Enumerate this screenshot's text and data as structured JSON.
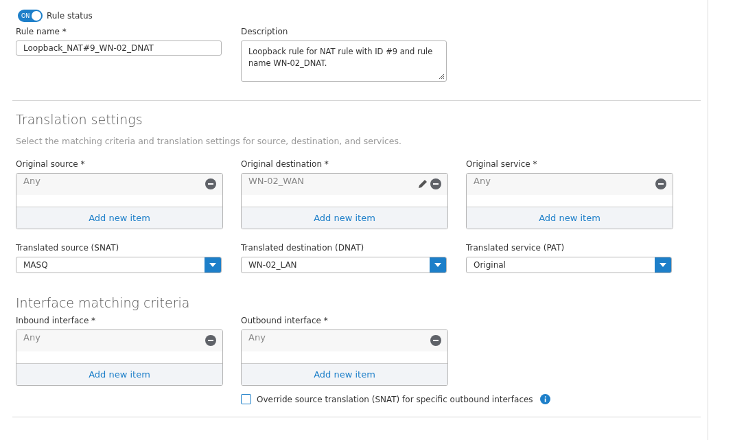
{
  "rule_status": {
    "label": "Rule status",
    "on": true,
    "switch_text": "ON"
  },
  "rule_name": {
    "label": "Rule name *",
    "value": "Loopback_NAT#9_WN-02_DNAT"
  },
  "description": {
    "label": "Description",
    "value": "Loopback rule for NAT rule with ID #9 and rule name WN-02_DNAT."
  },
  "translation_settings": {
    "title": "Translation settings",
    "subtitle": "Select the matching criteria and translation settings for source, destination, and services.",
    "lists": [
      {
        "label": "Original source *",
        "item": "Any",
        "editable": false,
        "add_label": "Add new item"
      },
      {
        "label": "Original destination *",
        "item": "WN-02_WAN",
        "editable": true,
        "add_label": "Add new item"
      },
      {
        "label": "Original service *",
        "item": "Any",
        "editable": false,
        "add_label": "Add new item"
      }
    ],
    "selects": [
      {
        "label": "Translated source (SNAT)",
        "value": "MASQ"
      },
      {
        "label": "Translated destination (DNAT)",
        "value": "WN-02_LAN"
      },
      {
        "label": "Translated service (PAT)",
        "value": "Original"
      }
    ]
  },
  "interface_matching": {
    "title": "Interface matching criteria",
    "lists": [
      {
        "label": "Inbound interface *",
        "item": "Any",
        "editable": false,
        "add_label": "Add new item"
      },
      {
        "label": "Outbound interface *",
        "item": "Any",
        "editable": false,
        "add_label": "Add new item"
      }
    ],
    "override": {
      "label": "Override source translation (SNAT) for specific outbound interfaces",
      "checked": false
    }
  }
}
